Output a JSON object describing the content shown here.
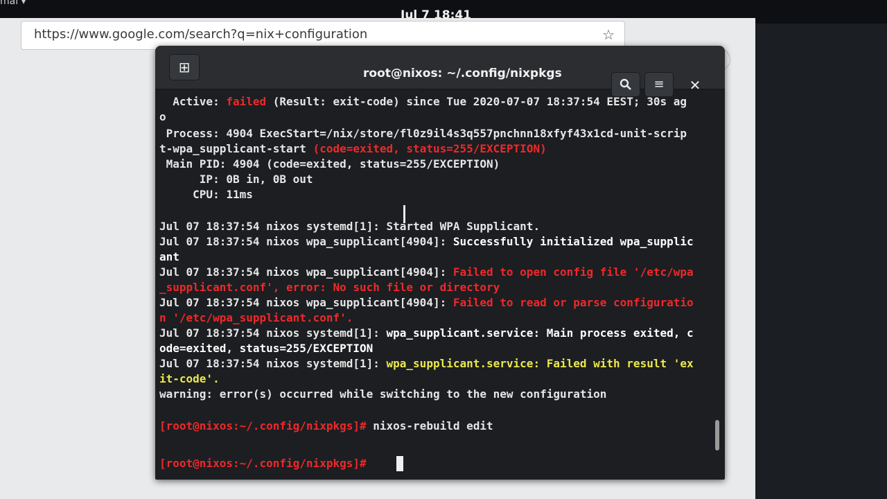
{
  "topbar": {
    "app_menu": "mal ▾",
    "clock": "Jul 7  18:41"
  },
  "browser": {
    "url": "https://www.google.com/search?q=nix+configuration",
    "star_icon": "☆",
    "button1_icon": "⊞",
    "button2_icon": "≡",
    "close_icon": "✕"
  },
  "terminal": {
    "title": "root@nixos: ~/.config/nixpkgs",
    "new_tab_icon": "⊞",
    "search_icon": "🔍",
    "menu_icon": "≡",
    "close_icon": "✕",
    "lines": {
      "l1a": "  Active: ",
      "l1b": "failed",
      "l1c": " (Result: exit-code) since Tue 2020-07-07 18:37:54 EEST; 30s ag",
      "l2": "o",
      "l3": " Process: 4904 ExecStart=/nix/store/fl0z9il4s3q557pnchnn18xfyf43x1cd-unit-scrip",
      "l4a": "t-wpa_supplicant-start ",
      "l4b": "(code=exited, status=255/EXCEPTION)",
      "l5": " Main PID: 4904 (code=exited, status=255/EXCEPTION)",
      "l6": "      IP: 0B in, 0B out",
      "l7": "     CPU: 11ms",
      "l8": "Jul 07 18:37:54 nixos systemd[1]: Started WPA Supplicant.",
      "l9a": "Jul 07 18:37:54 nixos wpa_supplicant[4904]: ",
      "l9b": "Successfully initialized wpa_supplic",
      "l10": "ant",
      "l11a": "Jul 07 18:37:54 nixos wpa_supplicant[4904]: ",
      "l11b": "Failed to open config file '/etc/wpa",
      "l12": "_supplicant.conf', error: No such file or directory",
      "l13a": "Jul 07 18:37:54 nixos wpa_supplicant[4904]: ",
      "l13b": "Failed to read or parse configuratio",
      "l14": "n '/etc/wpa_supplicant.conf'.",
      "l15a": "Jul 07 18:37:54 nixos systemd[1]: ",
      "l15b": "wpa_supplicant.service: Main process exited, c",
      "l16": "ode=exited, status=255/EXCEPTION",
      "l17a": "Jul 07 18:37:54 nixos systemd[1]: ",
      "l17b": "wpa_supplicant.service: Failed with result 'ex",
      "l18": "it-code'.",
      "l19": "warning: error(s) occurred while switching to the new configuration",
      "prompt1": "[root@nixos:~/.config/nixpkgs]# ",
      "cmd1": "nixos-rebuild edit",
      "prompt2": "[root@nixos:~/.config/nixpkgs]# "
    }
  },
  "colors": {
    "error": "#ef2929",
    "warning": "#ece94c",
    "terminal_bg": "#1c1e22"
  }
}
